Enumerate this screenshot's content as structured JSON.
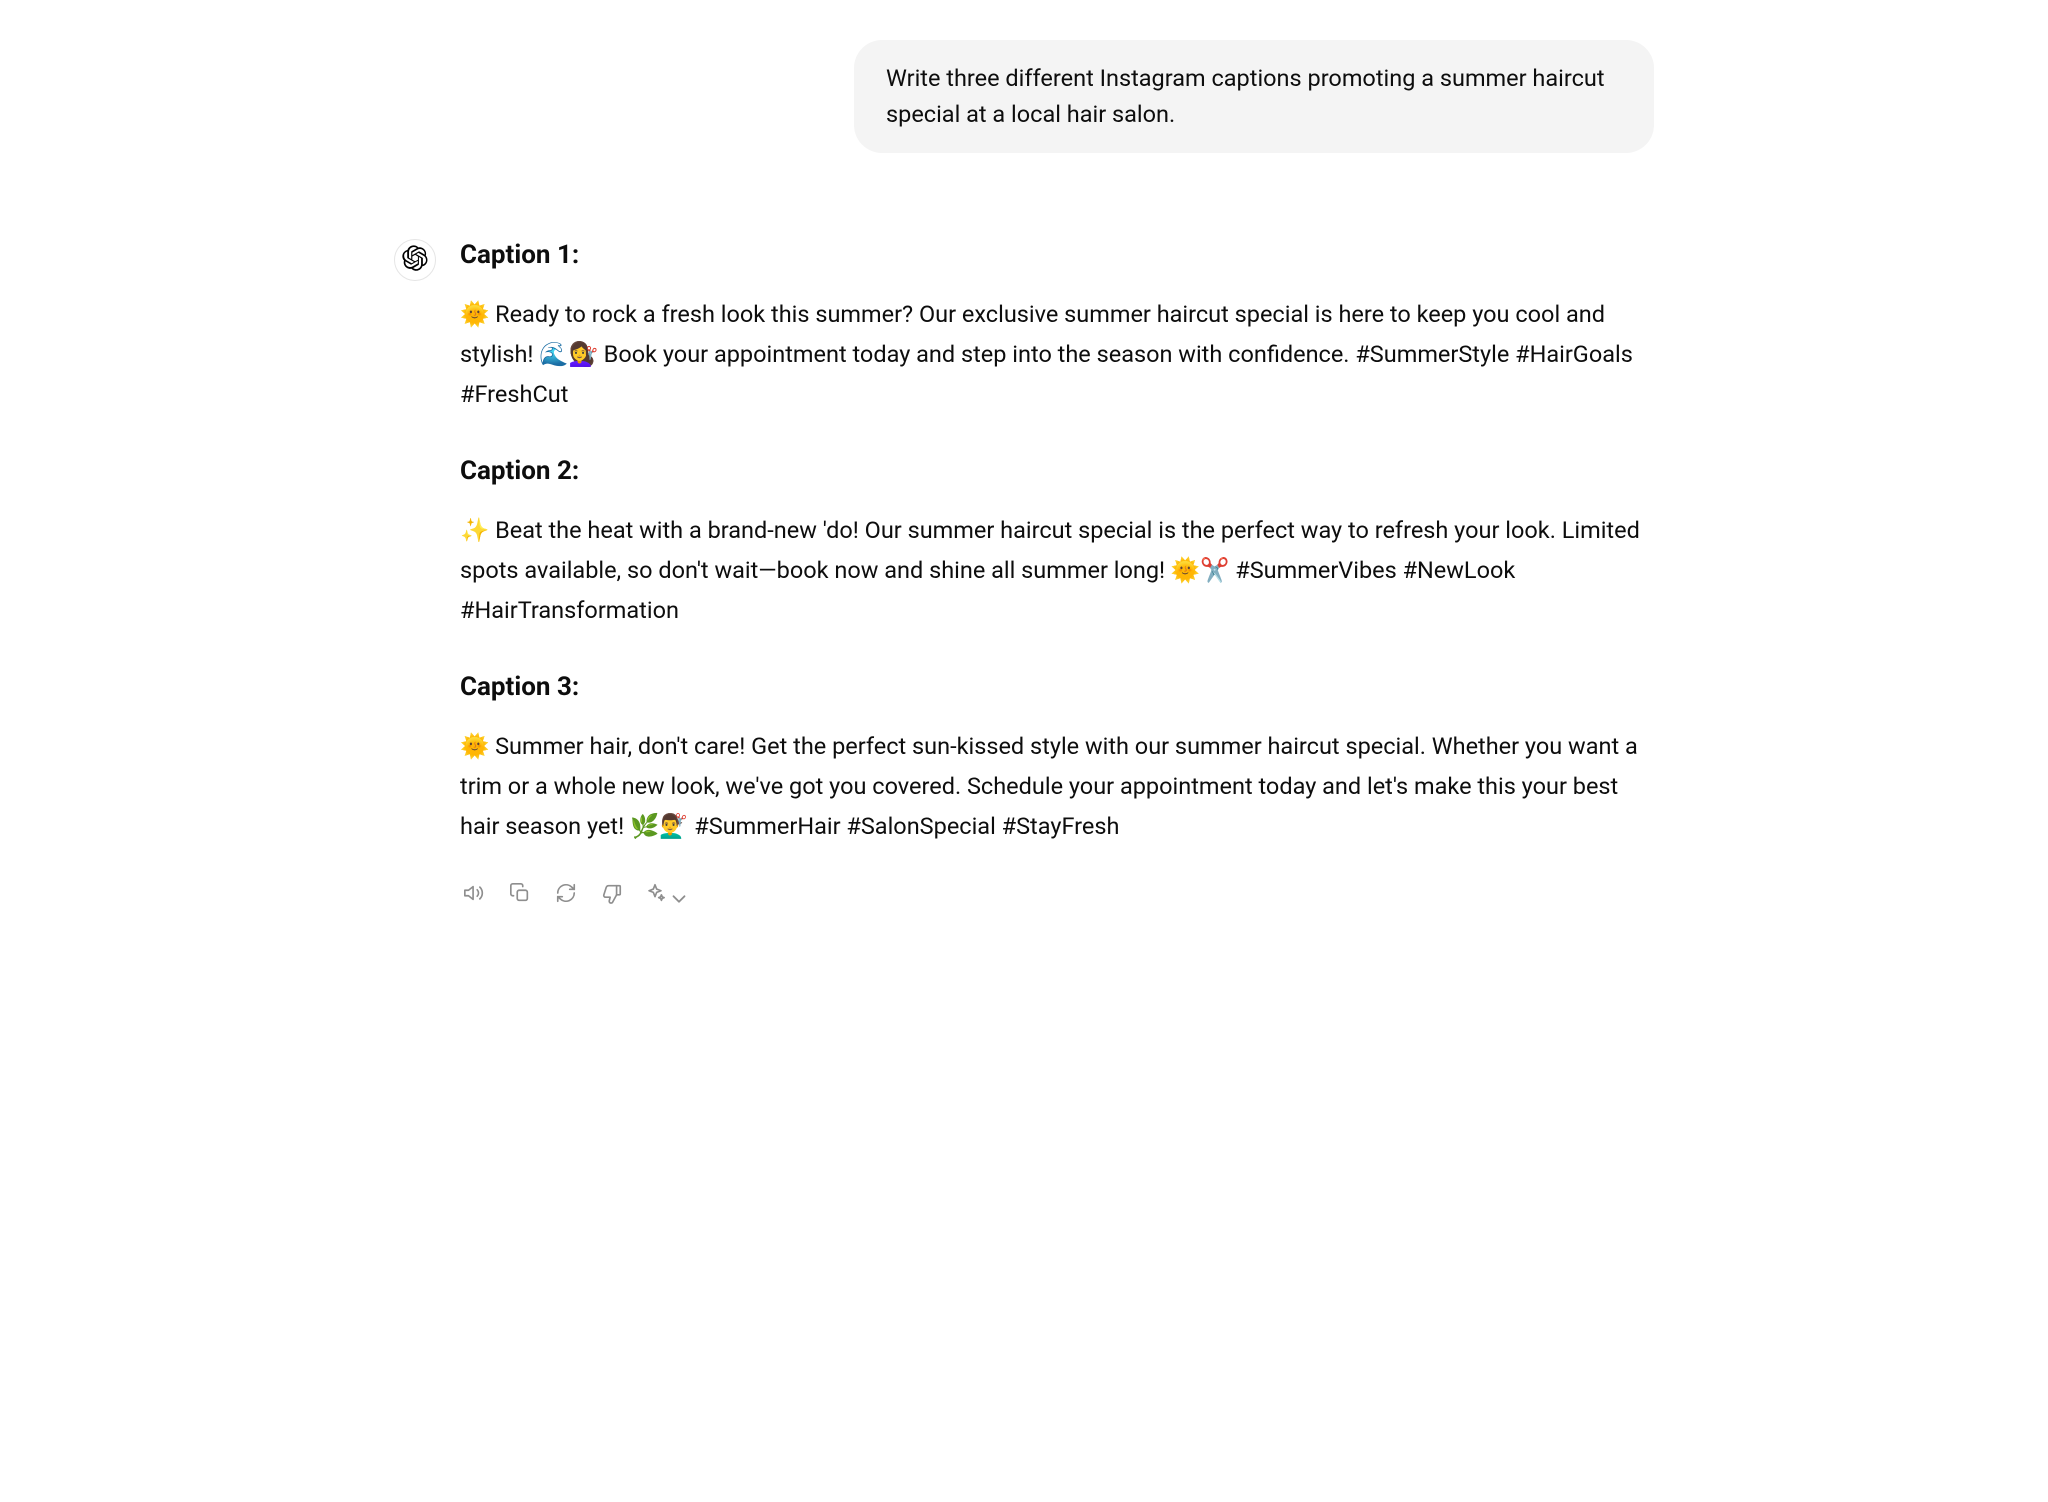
{
  "user_message": "Write three different Instagram captions promoting a summer haircut special at a local hair salon.",
  "assistant": {
    "caption1_heading": "Caption 1:",
    "caption1_body": "🌞 Ready to rock a fresh look this summer? Our exclusive summer haircut special is here to keep you cool and stylish! 🌊💇‍♀️ Book your appointment today and step into the season with confidence. #SummerStyle #HairGoals #FreshCut",
    "caption2_heading": "Caption 2:",
    "caption2_body": "✨ Beat the heat with a brand-new 'do! Our summer haircut special is the perfect way to refresh your look. Limited spots available, so don't wait—book now and shine all summer long! 🌞✂️ #SummerVibes #NewLook #HairTransformation",
    "caption3_heading": "Caption 3:",
    "caption3_body": "🌞 Summer hair, don't care! Get the perfect sun-kissed style with our summer haircut special. Whether you want a trim or a whole new look, we've got you covered. Schedule your appointment today and let's make this your best hair season yet! 🌿💇‍♂️ #SummerHair #SalonSpecial #StayFresh"
  }
}
